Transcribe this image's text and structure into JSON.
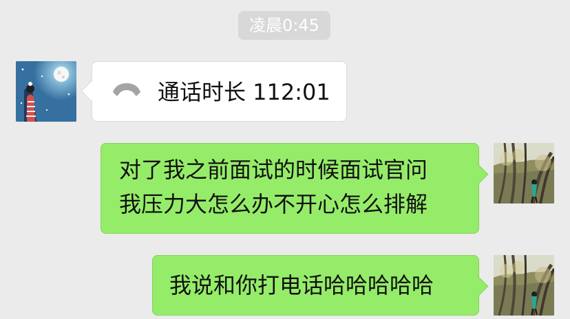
{
  "timestamp": "凌晨0:45",
  "messages": [
    {
      "side": "left",
      "type": "call",
      "icon": "phone-handset-icon",
      "text": "通话时长 112:01"
    },
    {
      "side": "right",
      "type": "text",
      "lines": [
        "对了我之前面试的时候面试官问",
        "我压力大怎么办不开心怎么排解"
      ]
    },
    {
      "side": "right",
      "type": "text",
      "lines": [
        "我说和你打电话哈哈哈哈哈"
      ]
    }
  ],
  "colors": {
    "background": "#ebebeb",
    "timestamp_bg": "#d8d8d8",
    "incoming_bubble": "#ffffff",
    "outgoing_bubble": "#95ec69"
  }
}
